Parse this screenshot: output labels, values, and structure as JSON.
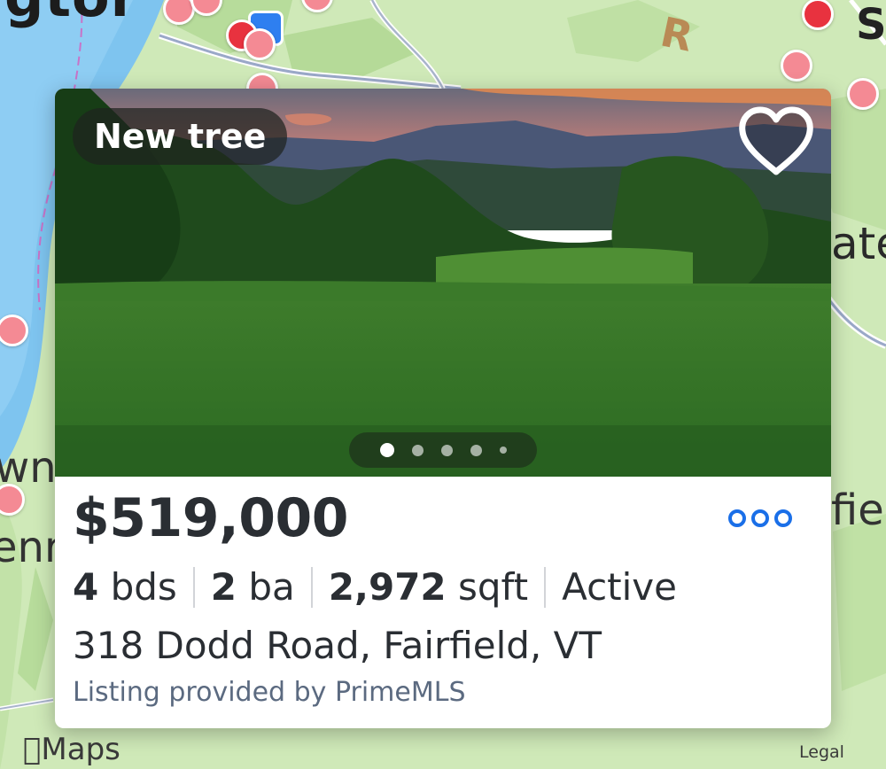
{
  "map": {
    "labels": {
      "top_left": "gtor",
      "top_right": "S",
      "right_mid": "ate",
      "right_low": "fiel",
      "left_a": "wn",
      "left_b": "enr"
    },
    "attribution": {
      "logo_text": "Maps",
      "legal": "Legal"
    }
  },
  "listing": {
    "badge": "New tree",
    "price": "$519,000",
    "beds_value": "4",
    "beds_unit": "bds",
    "baths_value": "2",
    "baths_unit": "ba",
    "sqft_value": "2,972",
    "sqft_unit": "sqft",
    "status": "Active",
    "address": "318 Dodd Road, Fairfield, VT",
    "provider": "Listing provided by PrimeMLS",
    "photo_count_indicator": 5,
    "active_photo_index": 1
  },
  "colors": {
    "accent": "#1a6fe8",
    "pin": "#f48a94",
    "pin_selected": "#e8323f",
    "text": "#2a2e33",
    "provider_text": "#5b6a80"
  },
  "icons": {
    "favorite": "heart-icon",
    "more": "more-dots-icon",
    "logo": "apple-icon"
  }
}
